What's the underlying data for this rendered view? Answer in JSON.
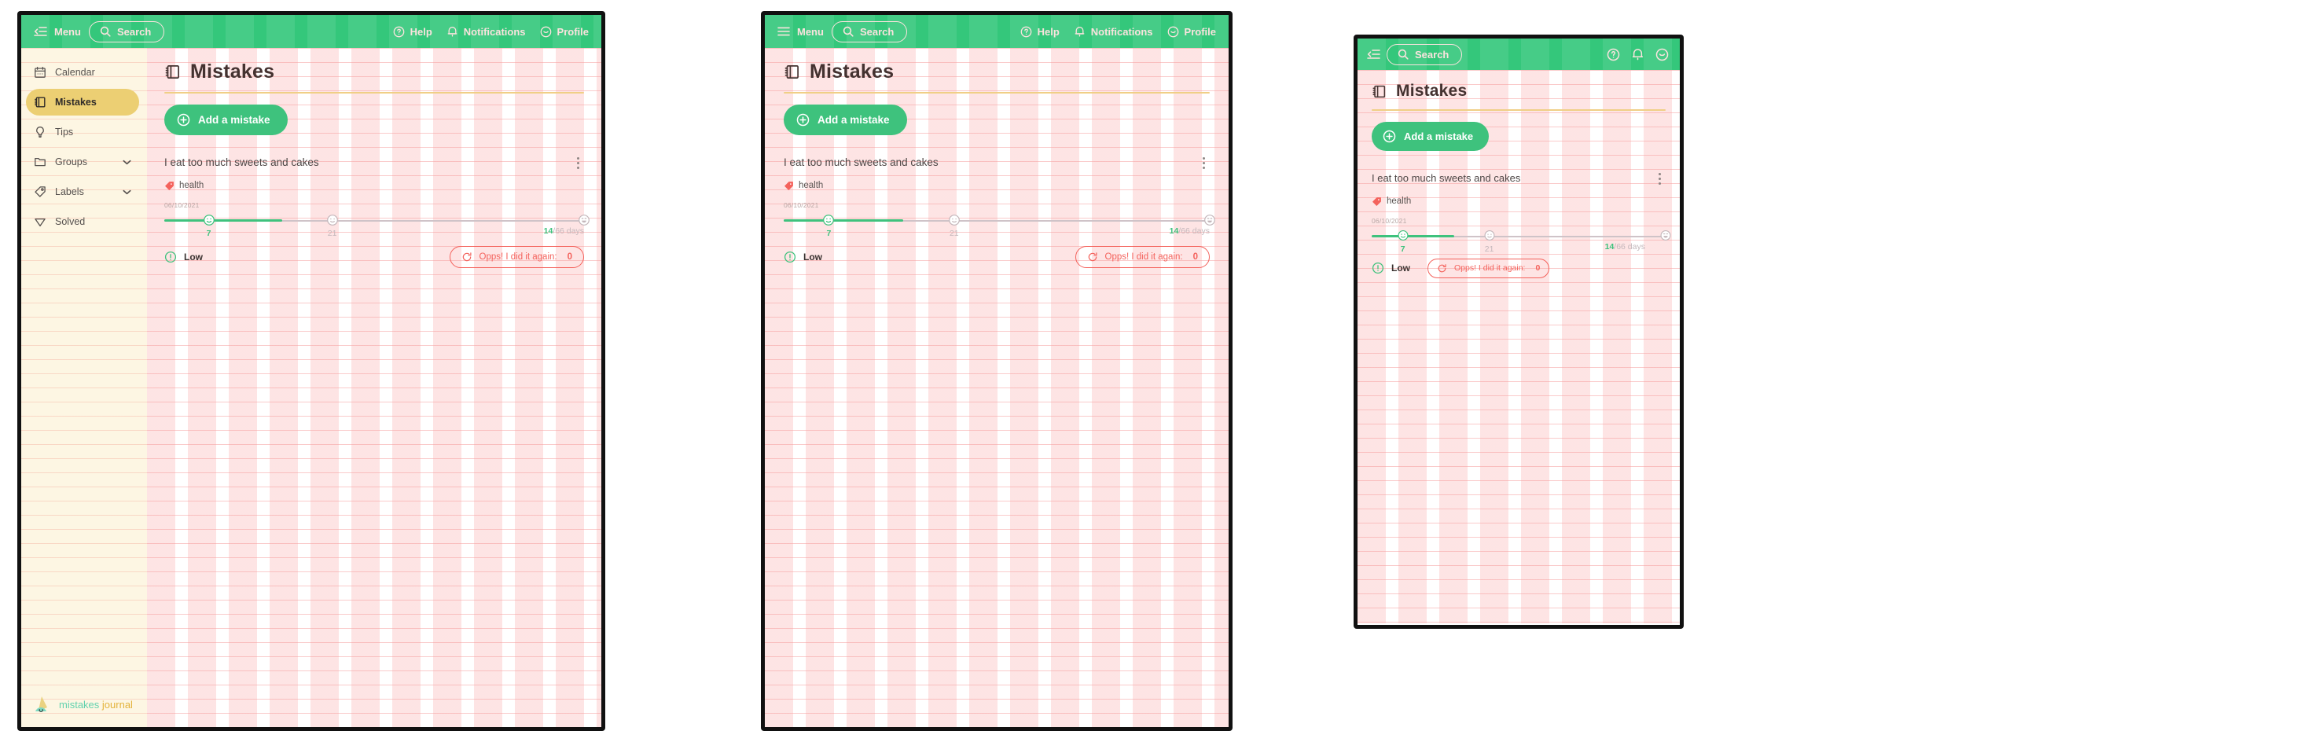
{
  "app": {
    "brand_part1": "mistakes",
    "brand_part2": "journal",
    "accent_green": "#34c77b",
    "accent_yellow": "#eccf73",
    "accent_red": "#f4625c",
    "paper_pink": "#ffffff",
    "paper_cream": "#fdf6e3"
  },
  "topbar": {
    "menu_label": "Menu",
    "search_label": "Search",
    "help_label": "Help",
    "notifications_label": "Notifications",
    "profile_label": "Profile",
    "menu_icon": "sidebar-collapse-icon",
    "menu_icon_tablet": "hamburger-icon",
    "search_icon": "search-icon",
    "help_icon": "question-circle-icon",
    "notifications_icon": "bell-icon",
    "profile_icon": "smiley-face-icon"
  },
  "sidebar": {
    "items": [
      {
        "label": "Calendar",
        "icon": "calendar-icon",
        "active": false,
        "expandable": false
      },
      {
        "label": "Mistakes",
        "icon": "notebook-icon",
        "active": true,
        "expandable": false
      },
      {
        "label": "Tips",
        "icon": "lightbulb-icon",
        "active": false,
        "expandable": false
      },
      {
        "label": "Groups",
        "icon": "folder-icon",
        "active": false,
        "expandable": true
      },
      {
        "label": "Labels",
        "icon": "tag-icon",
        "active": false,
        "expandable": true
      },
      {
        "label": "Solved",
        "icon": "diamond-icon",
        "active": false,
        "expandable": false
      }
    ]
  },
  "main": {
    "page_title": "Mistakes",
    "page_title_icon": "notebook-icon",
    "add_button_label": "Add a mistake",
    "add_button_icon": "plus-circle-icon"
  },
  "mistake_card": {
    "title": "I eat too much sweets and cakes",
    "menu_icon": "kebab-menu-icon",
    "tag_label": "health",
    "tag_icon": "tag-icon",
    "start_date": "06/10/2021",
    "priority_label": "Low",
    "priority_icon": "exclamation-circle-icon",
    "relapse_button_label": "Opps! I did it again:",
    "relapse_count": "0",
    "relapse_icon": "refresh-icon",
    "progress": {
      "current_days": "14",
      "total_days": "66",
      "days_suffix": "/66 days",
      "milestones": [
        {
          "label": "7",
          "position_pct": 10.6,
          "reached": true,
          "icon": "smiley-slight-icon"
        },
        {
          "label": "21",
          "position_pct": 40.0,
          "reached": false,
          "icon": "smiley-neutral-icon"
        },
        {
          "label": "66",
          "position_pct": 100.0,
          "reached": false,
          "icon": "smiley-grin-icon"
        }
      ],
      "fill_pct": 28.0
    }
  }
}
